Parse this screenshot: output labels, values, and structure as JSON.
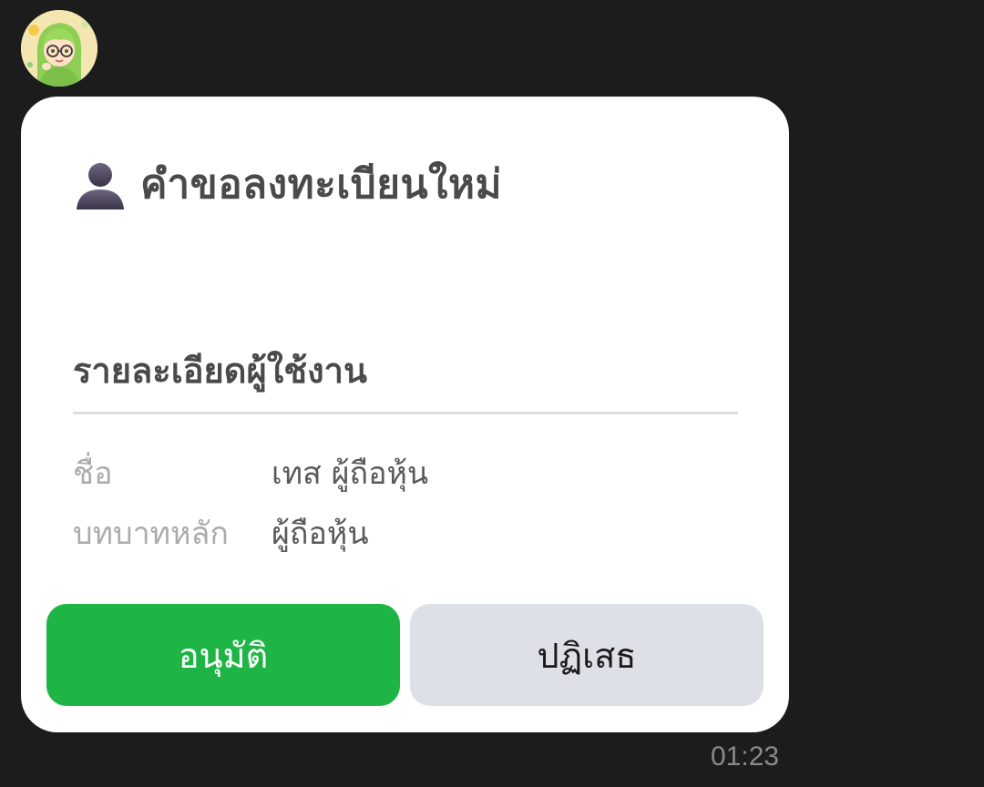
{
  "message": {
    "title": "คำขอลงทะเบียนใหม่",
    "section_title": "รายละเอียดผู้ใช้งาน",
    "details": [
      {
        "label": "ชื่อ",
        "value": "เทส ผู้ถือหุ้น"
      },
      {
        "label": "บทบาทหลัก",
        "value": "ผู้ถือหุ้น"
      }
    ],
    "buttons": {
      "approve_label": "อนุมัติ",
      "reject_label": "ปฏิเสธ"
    },
    "timestamp": "01:23"
  },
  "icons": {
    "avatar": "cartoon-girl-avatar-icon",
    "title": "user-silhouette-icon"
  },
  "colors": {
    "background": "#1c1c1c",
    "card": "#ffffff",
    "approve": "#1fb546",
    "reject": "#dde0e6"
  }
}
